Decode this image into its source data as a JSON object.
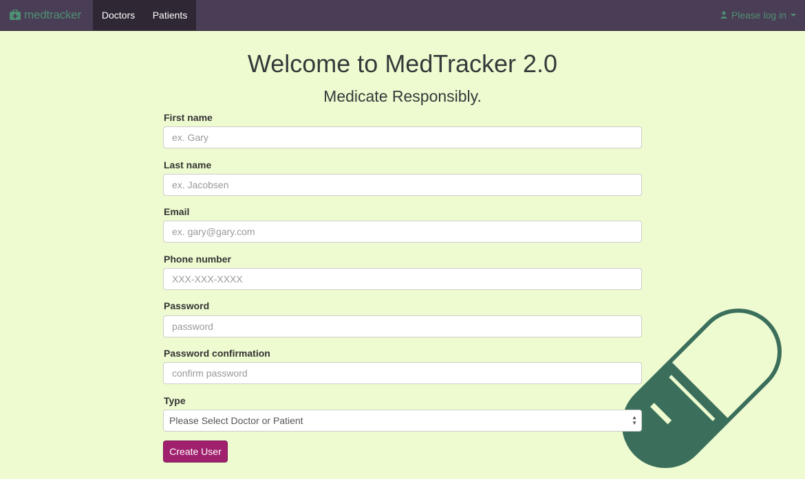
{
  "nav": {
    "brand": "medtracker",
    "tabs": [
      {
        "label": "Doctors"
      },
      {
        "label": "Patients"
      }
    ],
    "login_label": "Please log in"
  },
  "page": {
    "title": "Welcome to MedTracker 2.0",
    "subtitle": "Medicate Responsibly."
  },
  "form": {
    "first_name": {
      "label": "First name",
      "placeholder": "ex. Gary"
    },
    "last_name": {
      "label": "Last name",
      "placeholder": "ex. Jacobsen"
    },
    "email": {
      "label": "Email",
      "placeholder": "ex. gary@gary.com"
    },
    "phone": {
      "label": "Phone number",
      "placeholder": "XXX-XXX-XXXX"
    },
    "password": {
      "label": "Password",
      "placeholder": "password"
    },
    "password_confirmation": {
      "label": "Password confirmation",
      "placeholder": "confirm password"
    },
    "type": {
      "label": "Type",
      "selected": "Please Select Doctor or Patient"
    },
    "submit_label": "Create User"
  },
  "colors": {
    "navbar": "#4a3e56",
    "active_tab": "#2f2734",
    "brand": "#4f8f73",
    "background": "#eefbd0",
    "button": "#a0206e",
    "pill": "#3b6f5b"
  },
  "icons": {
    "brand": "medkit-icon",
    "login": "user-icon",
    "dropdown": "caret-down-icon",
    "decoration": "pill-icon"
  }
}
